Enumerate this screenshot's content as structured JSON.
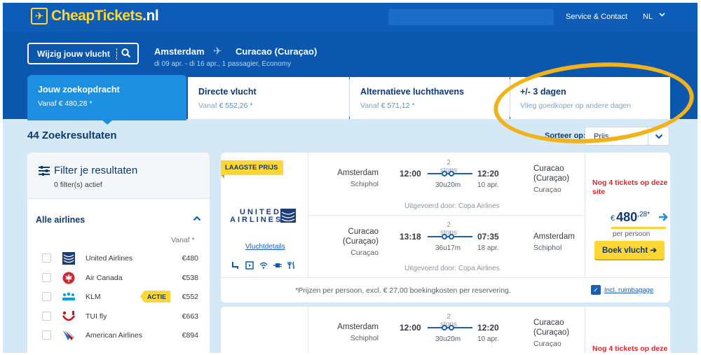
{
  "header": {
    "brand": "CheapTickets",
    "brand_suffix": ".nl",
    "service_link": "Service & Contact",
    "language": "NL"
  },
  "search": {
    "modify_label": "Wijzig jouw vlucht",
    "origin": "Amsterdam",
    "destination": "Curacao (Curaçao)",
    "details": "di 09 apr. - di 16 apr., 1 passagier, Economy"
  },
  "tabs": [
    {
      "title": "Jouw zoekopdracht",
      "sub_prefix": "Vanaf",
      "price": "€ 480,28 *"
    },
    {
      "title": "Directe vlucht",
      "sub_prefix": "Vanaf",
      "price": "€ 552,26 *"
    },
    {
      "title": "Alternatieve luchthavens",
      "sub_prefix": "Vanaf",
      "price": "€ 571,12 *"
    },
    {
      "title": "+/- 3 dagen",
      "sub": "Vlieg goedkoper op andere dagen"
    }
  ],
  "results": {
    "count_label": "44 Zoekresultaten",
    "sort_label": "Sorteer op:",
    "sort_value": "Prijs"
  },
  "filters": {
    "title": "Filter je resultaten",
    "active_count": "0 filter(s) actief",
    "airlines_title": "Alle airlines",
    "price_header": "Vanaf *",
    "airlines": [
      {
        "name": "United Airlines",
        "price": "€480",
        "badge": ""
      },
      {
        "name": "Air Canada",
        "price": "€538",
        "badge": ""
      },
      {
        "name": "KLM",
        "price": "€552",
        "badge": "ACTIE"
      },
      {
        "name": "TUI fly",
        "price": "€663",
        "badge": ""
      },
      {
        "name": "American Airlines",
        "price": "€894",
        "badge": ""
      }
    ]
  },
  "flight1": {
    "badge": "LAAGSTE PRIJS",
    "airline_logo_line1": "UNITED",
    "airline_logo_line2": "AIRLINES",
    "details_link": "Vluchtdetails",
    "outbound": {
      "from_city": "Amsterdam",
      "from_airport": "Schiphol",
      "stops": "2 stops",
      "dep_time": "12:00",
      "arr_time": "12:20",
      "duration": "30u20m",
      "arr_date": "10 apr.",
      "to_city": "Curacao (Curaçao)",
      "to_airport": "Curaçao",
      "operated_by": "Uitgevoerd door: Copa Airlines"
    },
    "inbound": {
      "from_city": "Curacao (Curaçao)",
      "from_airport": "Curaçao",
      "stops": "2 stops",
      "dep_time": "13:18",
      "arr_time": "07:35",
      "duration": "36u17m",
      "arr_date": "18 apr.",
      "to_city": "Amsterdam",
      "to_airport": "Schiphol",
      "operated_by": "Uitgevoerd door: Copa Airlines"
    },
    "tickets_left": "Nog 4 tickets op deze site",
    "currency": "€",
    "price_int": "480",
    "price_dec": ",28*",
    "per_person": "per persoon",
    "book_label": "Boek vlucht ➔",
    "footer_note": "*Prijzen per persoon, excl. € 27,00 boekingkosten per reservering.",
    "baggage_link": "Incl. ruimbagage"
  },
  "flight2": {
    "outbound": {
      "from_city": "Amsterdam",
      "from_airport": "Schiphol",
      "stops": "2 stops",
      "dep_time": "12:00",
      "arr_time": "12:20",
      "duration": "30u20m",
      "arr_date": "10 apr.",
      "to_city": "Curacao (Curaçao)",
      "to_airport": "Curaçao"
    },
    "tickets_left": "Nog 4 tickets op deze"
  },
  "colors": {
    "header_blue": "#0d5db8",
    "active_tab": "#1d8fe1",
    "accent_yellow": "#ffd633",
    "highlight_ring": "#f1b21a",
    "alert_red": "#d8262e"
  }
}
